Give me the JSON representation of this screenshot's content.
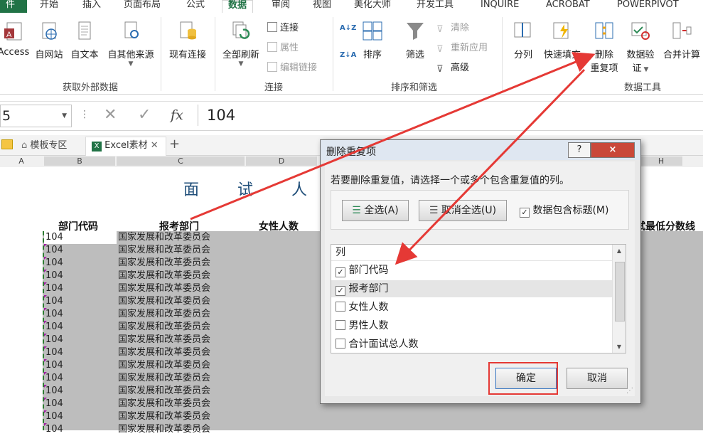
{
  "ribbon_tabs": [
    "件",
    "开始",
    "插入",
    "页面布局",
    "公式",
    "数据",
    "审阅",
    "视图",
    "美化大师",
    "开发工具",
    "INQUIRE",
    "ACROBAT",
    "POWERPIVOT"
  ],
  "ribbon": {
    "groups": {
      "external": "获取外部数据",
      "connections": "连接",
      "sort_filter": "排序和筛选",
      "data_tools": "数据工具"
    },
    "buttons": {
      "access": "Access",
      "from_web": "自网站",
      "from_text": "自文本",
      "from_other": "自其他来源",
      "existing": "现有连接",
      "refresh_all": "全部刷新",
      "connect": "连接",
      "properties": "属性",
      "edit_links": "编辑链接",
      "sort": "排序",
      "filter": "筛选",
      "clear": "清除",
      "reapply": "重新应用",
      "advanced": "高级",
      "split": "分列",
      "flash_fill": "快速填充",
      "remove_dup_1": "删除",
      "remove_dup_2": "重复项",
      "validation_1": "数据验",
      "validation_2": "证",
      "consolidate": "合并计算",
      "sort_az": "A Z",
      "sort_za": "Z A"
    }
  },
  "formula_bar": {
    "namebox": "5",
    "fx": "fx",
    "value": "104"
  },
  "sheet_tabs": [
    "模板专区",
    "Excel素材"
  ],
  "column_headers": [
    "A",
    "B",
    "C",
    "D",
    "H"
  ],
  "sheet": {
    "title_chars": [
      "面",
      "试",
      "人"
    ],
    "headers": {
      "b": "部门代码",
      "c": "报考部门",
      "d": "女性人数",
      "h": "试最低分数线"
    },
    "rows": [
      [
        "104",
        "国家发展和改革委员会"
      ],
      [
        "104",
        "国家发展和改革委员会"
      ],
      [
        "104",
        "国家发展和改革委员会"
      ],
      [
        "104",
        "国家发展和改革委员会"
      ],
      [
        "104",
        "国家发展和改革委员会"
      ],
      [
        "104",
        "国家发展和改革委员会"
      ],
      [
        "104",
        "国家发展和改革委员会"
      ],
      [
        "104",
        "国家发展和改革委员会"
      ],
      [
        "104",
        "国家发展和改革委员会"
      ],
      [
        "104",
        "国家发展和改革委员会"
      ],
      [
        "104",
        "国家发展和改革委员会"
      ],
      [
        "104",
        "国家发展和改革委员会"
      ],
      [
        "104",
        "国家发展和改革委员会"
      ],
      [
        "104",
        "国家发展和改革委员会"
      ],
      [
        "104",
        "国家发展和改革委员会"
      ],
      [
        "104",
        "国家发展和改革委员会"
      ]
    ]
  },
  "dialog": {
    "title": "删除重复项",
    "help": "?",
    "close": "×",
    "instruction": "若要删除重复值，请选择一个或多个包含重复值的列。",
    "select_all": "全选(A)",
    "unselect_all": "取消全选(U)",
    "has_headers": "数据包含标题(M)",
    "has_headers_checked": true,
    "list_header": "列",
    "columns": [
      {
        "label": "部门代码",
        "checked": true
      },
      {
        "label": "报考部门",
        "checked": true
      },
      {
        "label": "女性人数",
        "checked": false
      },
      {
        "label": "男性人数",
        "checked": false
      },
      {
        "label": "合计面试总人数",
        "checked": false
      }
    ],
    "ok": "确定",
    "cancel": "取消"
  },
  "colors": {
    "excel_green": "#217346",
    "annotation_red": "#e53935",
    "selection_gray": "#bdbdbd"
  }
}
